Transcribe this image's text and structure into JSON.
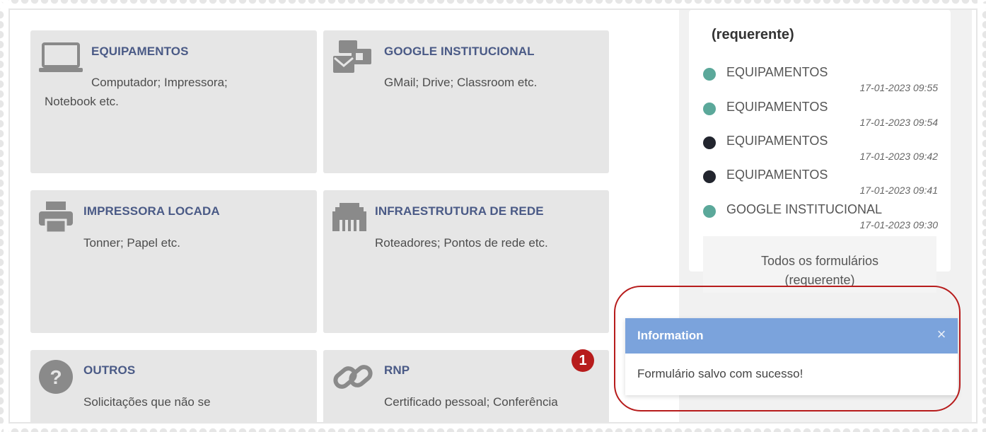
{
  "categories": [
    {
      "title": "EQUIPAMENTOS",
      "desc_line1": "Computador; Impressora;",
      "desc_line2": "Notebook etc.",
      "icon": "laptop-icon"
    },
    {
      "title": "GOOGLE INSTITUCIONAL",
      "desc_line1": "GMail; Drive; Classroom etc.",
      "icon": "google-services-icon"
    },
    {
      "title": "IMPRESSORA LOCADA",
      "desc_line1": "Tonner; Papel etc.",
      "icon": "printer-icon"
    },
    {
      "title": "INFRAESTRUTURA DE REDE",
      "desc_line1": "Roteadores; Pontos de rede etc.",
      "icon": "network-port-icon"
    },
    {
      "title": "OUTROS",
      "desc_line1": "Solicitações que não se",
      "icon": "question-icon"
    },
    {
      "title": "RNP",
      "desc_line1": "Certificado pessoal; Conferência",
      "icon": "link-icon"
    }
  ],
  "sidebar": {
    "title": "(requerente)",
    "requests": [
      {
        "name": "EQUIPAMENTOS",
        "time": "17-01-2023 09:55",
        "status_color": "#5ba89a"
      },
      {
        "name": "EQUIPAMENTOS",
        "time": "17-01-2023 09:54",
        "status_color": "#5ba89a"
      },
      {
        "name": "EQUIPAMENTOS",
        "time": "17-01-2023 09:42",
        "status_color": "#22252e"
      },
      {
        "name": "EQUIPAMENTOS",
        "time": "17-01-2023 09:41",
        "status_color": "#22252e"
      },
      {
        "name": "GOOGLE INSTITUCIONAL",
        "time": "17-01-2023 09:30",
        "status_color": "#5ba89a"
      }
    ],
    "all_forms_line1": "Todos os formulários",
    "all_forms_line2": "(requerente)"
  },
  "annotation": {
    "badge": "1"
  },
  "toast": {
    "title": "Information",
    "close": "×",
    "message": "Formulário salvo com sucesso!"
  },
  "colors": {
    "accent": "#4a5a86",
    "toast_header": "#7ba3dc",
    "annotation": "#b71c1c"
  }
}
